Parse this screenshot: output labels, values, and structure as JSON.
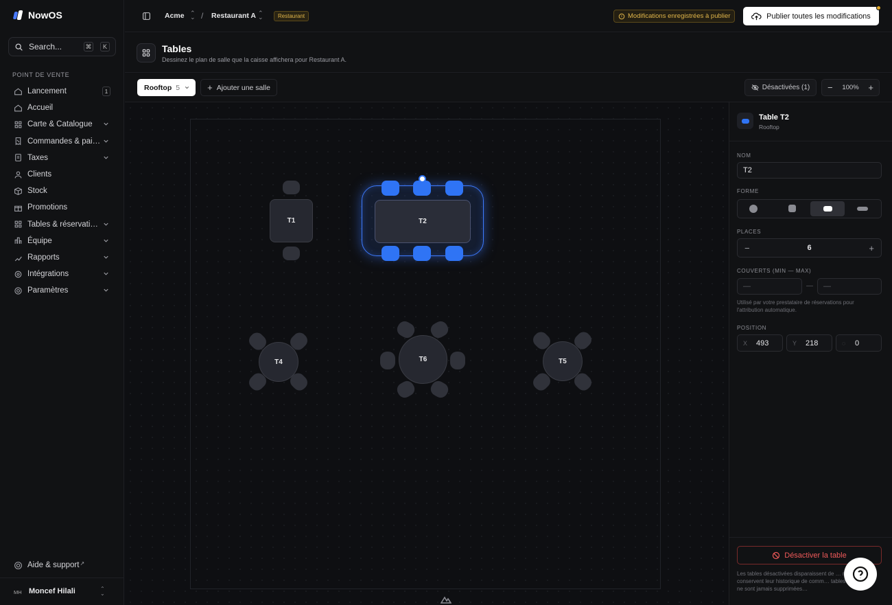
{
  "app": {
    "name": "NowOS"
  },
  "sidebar": {
    "search": {
      "placeholder": "Search...",
      "kbd": [
        "⌘",
        "K"
      ]
    },
    "section_title": "POINT DE VENTE",
    "items": [
      {
        "label": "Lancement",
        "icon": "home-icon",
        "badge": "1"
      },
      {
        "label": "Accueil",
        "icon": "home-icon"
      },
      {
        "label": "Carte & Catalogue",
        "icon": "grid-icon",
        "chevron": true
      },
      {
        "label": "Commandes & pai…",
        "icon": "receipt-icon",
        "chevron": true
      },
      {
        "label": "Taxes",
        "icon": "document-icon",
        "chevron": true
      },
      {
        "label": "Clients",
        "icon": "user-icon"
      },
      {
        "label": "Stock",
        "icon": "box-icon"
      },
      {
        "label": "Promotions",
        "icon": "gift-icon"
      },
      {
        "label": "Tables & réservati…",
        "icon": "grid-icon",
        "chevron": true
      },
      {
        "label": "Équipe",
        "icon": "team-icon",
        "chevron": true
      },
      {
        "label": "Rapports",
        "icon": "chart-icon",
        "chevron": true
      },
      {
        "label": "Intégrations",
        "icon": "plug-icon",
        "chevron": true
      },
      {
        "label": "Paramètres",
        "icon": "gear-icon",
        "chevron": true
      }
    ],
    "help": "Aide & support",
    "user": {
      "initials": "MH",
      "name": "Moncef Hilali"
    }
  },
  "topbar": {
    "org": "Acme",
    "restaurant": "Restaurant A",
    "tag": "Restaurant",
    "notice": "Modifications enregistrées à publier",
    "publish": "Publier toutes les modifications"
  },
  "header": {
    "title": "Tables",
    "subtitle": "Dessinez le plan de salle que la caisse affichera pour Restaurant A."
  },
  "toolbar": {
    "room": "Rooftop",
    "room_count": "5",
    "add_room": "Ajouter une salle",
    "deactivated": "Désactivées (1)",
    "zoom": "100%"
  },
  "floor": {
    "tables": [
      {
        "id": "T1",
        "shape": "square",
        "seats": 2
      },
      {
        "id": "T2",
        "shape": "rectangle",
        "seats": 6,
        "selected": true
      },
      {
        "id": "T4",
        "shape": "round",
        "seats": 4
      },
      {
        "id": "T6",
        "shape": "round",
        "seats": 6
      },
      {
        "id": "T5",
        "shape": "round",
        "seats": 4
      }
    ]
  },
  "panel": {
    "title": "Table T2",
    "subtitle": "Rooftop",
    "name_label": "NOM",
    "name_value": "T2",
    "shape_label": "FORME",
    "seats_label": "PLACES",
    "seats_value": "6",
    "covers_label": "COUVERTS (MIN — MAX)",
    "covers_min_placeholder": "—",
    "covers_max_placeholder": "—",
    "covers_sep": "—",
    "covers_hint": "Utilisé par votre prestataire de réservations pour l'attribution automatique.",
    "position_label": "POSITION",
    "x_label": "X",
    "x_value": "493",
    "y_label": "Y",
    "y_value": "218",
    "r_value": "0",
    "deactivate": "Désactiver la table",
    "footnote": "Les tables désactivées disparaissent de … mais conservent leur historique de comm… tables publiées ne sont jamais supprimées…"
  },
  "colors": {
    "accent": "#2f74f5",
    "warning": "#e0b54a",
    "danger": "#f05a5a"
  }
}
